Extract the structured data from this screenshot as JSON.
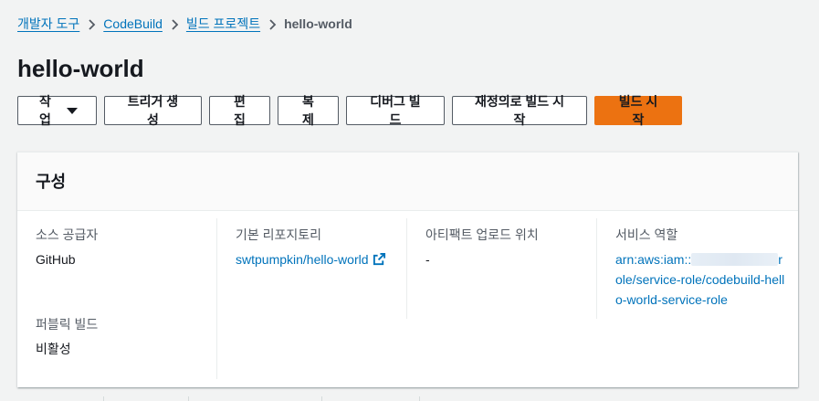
{
  "breadcrumb": {
    "items": [
      "개발자 도구",
      "CodeBuild",
      "빌드 프로젝트"
    ],
    "current": "hello-world"
  },
  "page": {
    "title": "hello-world"
  },
  "actions": {
    "actions_label": "작업",
    "create_trigger": "트리거 생성",
    "edit": "편집",
    "clone": "복제",
    "debug_build": "디버그 빌드",
    "rebuild_with_overrides": "재정의로 빌드 시작",
    "start_build": "빌드 시작"
  },
  "config": {
    "title": "구성",
    "source_provider": {
      "label": "소스 공급자",
      "value": "GitHub"
    },
    "primary_repo": {
      "label": "기본 리포지토리",
      "value": "swtpumpkin/hello-world"
    },
    "artifact_location": {
      "label": "아티팩트 업로드 위치",
      "value": "-"
    },
    "service_role": {
      "label": "서비스 역할",
      "prefix": "arn:aws:iam::",
      "suffix": "role/service-role/codebuild-hello-world-service-role"
    },
    "public_build": {
      "label": "퍼블릭 빌드",
      "value": "비활성"
    }
  },
  "colors": {
    "accent": "#ec7211",
    "link": "#0073bb"
  }
}
